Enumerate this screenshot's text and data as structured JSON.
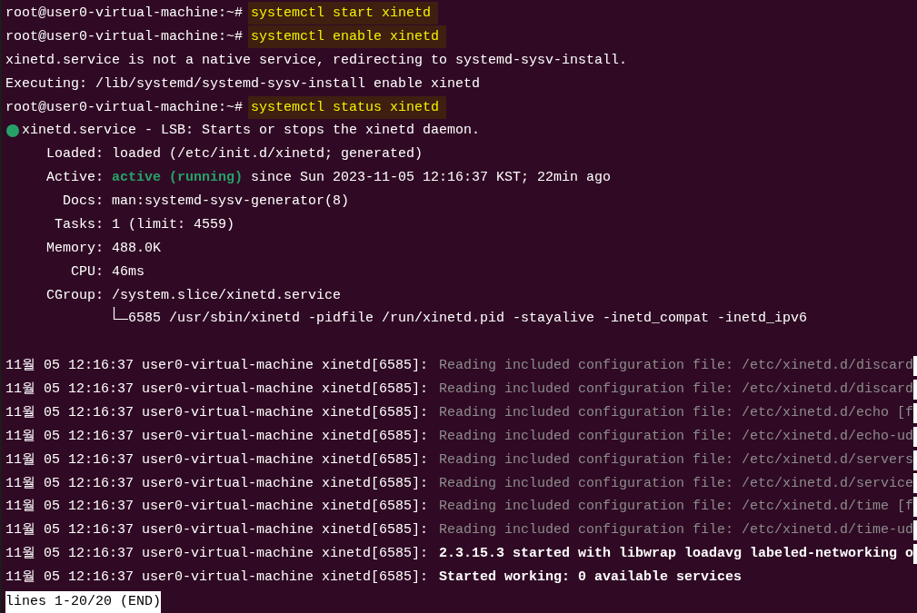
{
  "terminal": {
    "lines": [
      {
        "kind": "prompt",
        "prompt": "root@user0-virtual-machine:~#",
        "command": "systemctl start xinetd",
        "highlighted": true
      },
      {
        "kind": "prompt",
        "prompt": "root@user0-virtual-machine:~#",
        "command": "systemctl enable xinetd",
        "highlighted": true
      },
      {
        "kind": "output",
        "text": "xinetd.service is not a native service, redirecting to systemd-sysv-install."
      },
      {
        "kind": "output",
        "text": "Executing: /lib/systemd/systemd-sysv-install enable xinetd"
      },
      {
        "kind": "prompt",
        "prompt": "root@user0-virtual-machine:~#",
        "command": "systemctl status xinetd",
        "highlighted": true
      }
    ]
  },
  "status": {
    "color": "#26a269",
    "title": "xinetd.service - LSB: Starts or stops the xinetd daemon.",
    "fields": [
      {
        "kind": "plain",
        "label": "Loaded:",
        "value": "loaded (/etc/init.d/xinetd; generated)"
      },
      {
        "kind": "state",
        "label": "Active:",
        "state_text": "active (running)",
        "value": "since Sun 2023-11-05 12:16:37 KST; 22min ago"
      },
      {
        "kind": "plain",
        "label": "Docs:",
        "value": "man:systemd-sysv-generator(8)"
      },
      {
        "kind": "plain",
        "label": "Tasks:",
        "value": "1 (limit: 4559)"
      },
      {
        "kind": "plain",
        "label": "Memory:",
        "value": "488.0K"
      },
      {
        "kind": "plain",
        "label": "CPU:",
        "value": "46ms"
      },
      {
        "kind": "tree",
        "label": "CGroup:",
        "value": "/system.slice/xinetd.service",
        "children": [
          {
            "value": "6585 /usr/sbin/xinetd -pidfile /run/xinetd.pid -stayalive -inetd_compat -inetd_ipv6"
          }
        ]
      }
    ]
  },
  "journal": [
    {
      "prefix": "11월 05 12:16:37 user0-virtual-machine xinetd[6585]:",
      "message": "Reading included configuration file: /etc/xinetd.d/discard",
      "kind": "debug",
      "truncated": true
    },
    {
      "prefix": "11월 05 12:16:37 user0-virtual-machine xinetd[6585]:",
      "message": "Reading included configuration file: /etc/xinetd.d/discard",
      "kind": "debug",
      "truncated": true
    },
    {
      "prefix": "11월 05 12:16:37 user0-virtual-machine xinetd[6585]:",
      "message": "Reading included configuration file: /etc/xinetd.d/echo [f",
      "kind": "debug",
      "truncated": true
    },
    {
      "prefix": "11월 05 12:16:37 user0-virtual-machine xinetd[6585]:",
      "message": "Reading included configuration file: /etc/xinetd.d/echo-ud",
      "kind": "debug",
      "truncated": true
    },
    {
      "prefix": "11월 05 12:16:37 user0-virtual-machine xinetd[6585]:",
      "message": "Reading included configuration file: /etc/xinetd.d/servers",
      "kind": "debug",
      "truncated": true
    },
    {
      "prefix": "11월 05 12:16:37 user0-virtual-machine xinetd[6585]:",
      "message": "Reading included configuration file: /etc/xinetd.d/service",
      "kind": "debug",
      "truncated": true
    },
    {
      "prefix": "11월 05 12:16:37 user0-virtual-machine xinetd[6585]:",
      "message": "Reading included configuration file: /etc/xinetd.d/time [f",
      "kind": "debug",
      "truncated": true
    },
    {
      "prefix": "11월 05 12:16:37 user0-virtual-machine xinetd[6585]:",
      "message": "Reading included configuration file: /etc/xinetd.d/time-ud",
      "kind": "debug",
      "truncated": true
    },
    {
      "prefix": "11월 05 12:16:37 user0-virtual-machine xinetd[6585]:",
      "message": "2.3.15.3 started with libwrap loadavg labeled-networking o",
      "kind": "notice",
      "truncated": true
    },
    {
      "prefix": "11월 05 12:16:37 user0-virtual-machine xinetd[6585]:",
      "message": "Started working: 0 available services",
      "kind": "notice",
      "truncated": false
    }
  ],
  "pager_status": "lines 1-20/20 (END)"
}
